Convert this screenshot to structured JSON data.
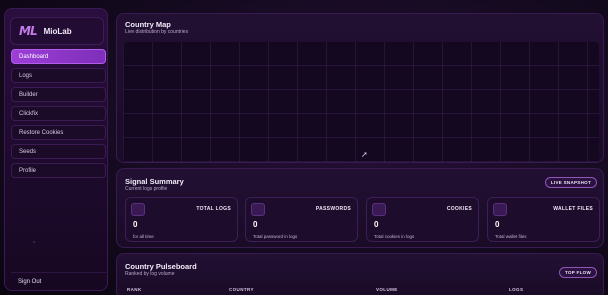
{
  "sidebar": {
    "brand_mark": "ML",
    "brand_name": "MioLab",
    "items": [
      {
        "label": "Dashboard",
        "active": true
      },
      {
        "label": "Logs"
      },
      {
        "label": "Builder"
      },
      {
        "label": "Clickfix"
      },
      {
        "label": "Restore Cookies"
      },
      {
        "label": "Seeds"
      },
      {
        "label": "Profile"
      }
    ],
    "sign_out": "Sign Out"
  },
  "country_map": {
    "title": "Country Map",
    "subtitle": "Live distribution by countries"
  },
  "signal_summary": {
    "title": "Signal Summary",
    "subtitle": "Current logs profile",
    "badge": "LIVE SNAPSHOT",
    "cards": [
      {
        "label": "TOTAL LOGS",
        "value": "0",
        "caption": "for all time"
      },
      {
        "label": "PASSWORDS",
        "value": "0",
        "caption": "Total password in logs"
      },
      {
        "label": "COOKIES",
        "value": "0",
        "caption": "Total cookies in logs"
      },
      {
        "label": "WALLET FILES",
        "value": "0",
        "caption": "Total wallet files"
      }
    ]
  },
  "pulseboard": {
    "title": "Country Pulseboard",
    "subtitle": "Ranked by log volume",
    "badge": "TOP FLOW",
    "columns": [
      "RANK",
      "COUNTRY",
      "VOLUME",
      "LOGS"
    ]
  },
  "colors": {
    "accent": "#9d3ed9",
    "background": "#0d0614",
    "panel": "#1a0b27"
  }
}
